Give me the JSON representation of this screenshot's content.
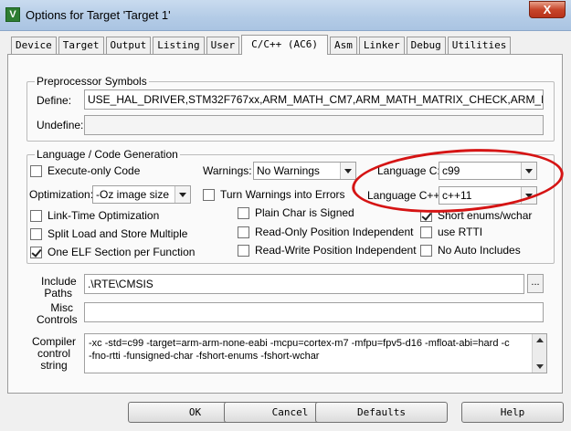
{
  "window": {
    "title": "Options for Target 'Target 1'",
    "close_label": "X"
  },
  "tabs": [
    "Device",
    "Target",
    "Output",
    "Listing",
    "User",
    "C/C++ (AC6)",
    "Asm",
    "Linker",
    "Debug",
    "Utilities"
  ],
  "preprocessor": {
    "group_label": "Preprocessor Symbols",
    "define_label": "Define:",
    "define_value": "USE_HAL_DRIVER,STM32F767xx,ARM_MATH_CM7,ARM_MATH_MATRIX_CHECK,ARM_MATH_RO",
    "undefine_label": "Undefine:",
    "undefine_value": ""
  },
  "language": {
    "group_label": "Language / Code Generation",
    "execute_only": "Execute-only Code",
    "optimization_label": "Optimization:",
    "optimization_value": "-Oz image size",
    "lto": "Link-Time Optimization",
    "split_load": "Split Load and Store Multiple",
    "one_elf": "One ELF Section per Function",
    "warnings_label": "Warnings:",
    "warnings_value": "No Warnings",
    "warnings_errors": "Turn Warnings into Errors",
    "plain_char": "Plain Char is Signed",
    "ropi": "Read-Only Position Independent",
    "rwpi": "Read-Write Position Independent",
    "lang_c_label": "Language C:",
    "lang_c_value": "c99",
    "lang_cpp_label": "Language C++:",
    "lang_cpp_value": "c++11",
    "short_enums": "Short enums/wchar",
    "use_rtti": "use RTTI",
    "no_auto_includes": "No Auto Includes"
  },
  "include": {
    "include_label_1": "Include",
    "include_label_2": "Paths",
    "include_value": ".\\RTE\\CMSIS",
    "browse_label": "...",
    "misc_label_1": "Misc",
    "misc_label_2": "Controls",
    "misc_value": "",
    "compiler_label_1": "Compiler",
    "compiler_label_2": "control",
    "compiler_label_3": "string",
    "compiler_line_1": "-xc -std=c99 -target=arm-arm-none-eabi -mcpu=cortex-m7 -mfpu=fpv5-d16 -mfloat-abi=hard -c",
    "compiler_line_2": "-fno-rtti -funsigned-char -fshort-enums -fshort-wchar"
  },
  "buttons": {
    "ok": "OK",
    "cancel": "Cancel",
    "defaults": "Defaults",
    "help": "Help"
  },
  "colors": {
    "annotation": "#d51414"
  }
}
